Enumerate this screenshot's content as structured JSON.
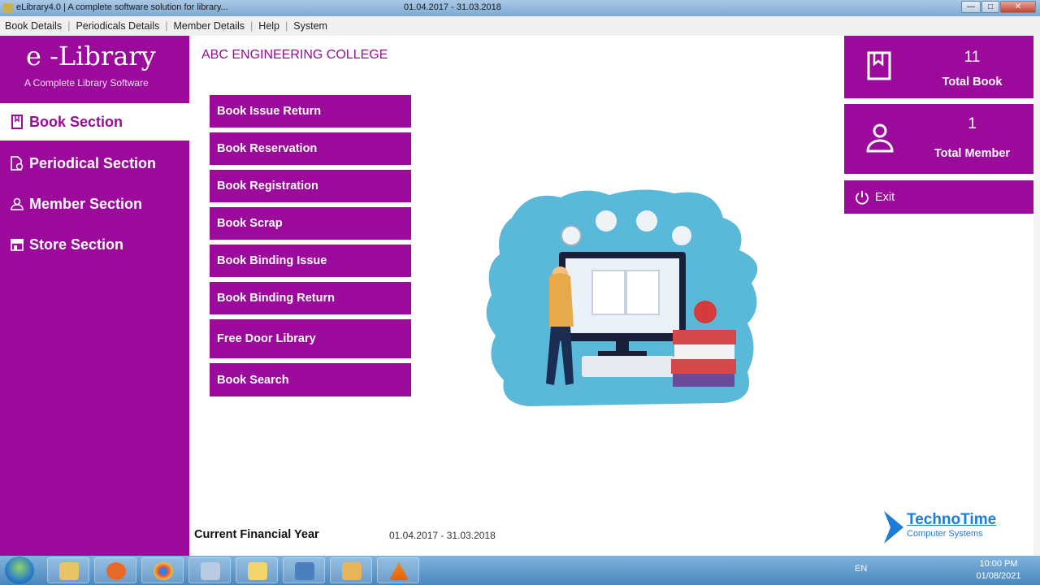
{
  "window": {
    "title": "eLibrary4.0  |  A complete software solution for library...",
    "financial_year": "01.04.2017  -  31.03.2018",
    "minimize": "—",
    "maximize": "□",
    "close": "✕"
  },
  "menu": [
    "Book Details",
    "Periodicals Details",
    "Member Details",
    "Help",
    "System"
  ],
  "logo": {
    "name": "e -Library",
    "tagline": "A Complete Library Software"
  },
  "sidebar": {
    "items": [
      {
        "label": "Book Section",
        "icon": "book-icon"
      },
      {
        "label": "Periodical Section",
        "icon": "periodical-icon"
      },
      {
        "label": "Member Section",
        "icon": "person-icon"
      },
      {
        "label": "Store Section",
        "icon": "store-icon"
      }
    ]
  },
  "college_name": "ABC ENGINEERING COLLEGE",
  "actions": [
    "Book Issue Return",
    "Book Reservation",
    "Book Registration",
    "Book Scrap",
    "Book Binding Issue",
    "Book Binding Return",
    "Free Door Library",
    "Book Search"
  ],
  "stats": {
    "books": {
      "value": "11",
      "label": "Total Book"
    },
    "members": {
      "value": "1",
      "label": "Total Member"
    }
  },
  "exit_label": "Exit",
  "footer": {
    "label": "Current Financial Year",
    "value": "01.04.2017  -  31.03.2018"
  },
  "brand": {
    "name": "TechnoTime",
    "sub": "Computer Systems"
  },
  "taskbar": {
    "lang": "EN",
    "time": "10:00 PM",
    "date": "01/08/2021"
  },
  "colors": {
    "accent": "#9b0a9b",
    "brand": "#1f7bd8"
  }
}
